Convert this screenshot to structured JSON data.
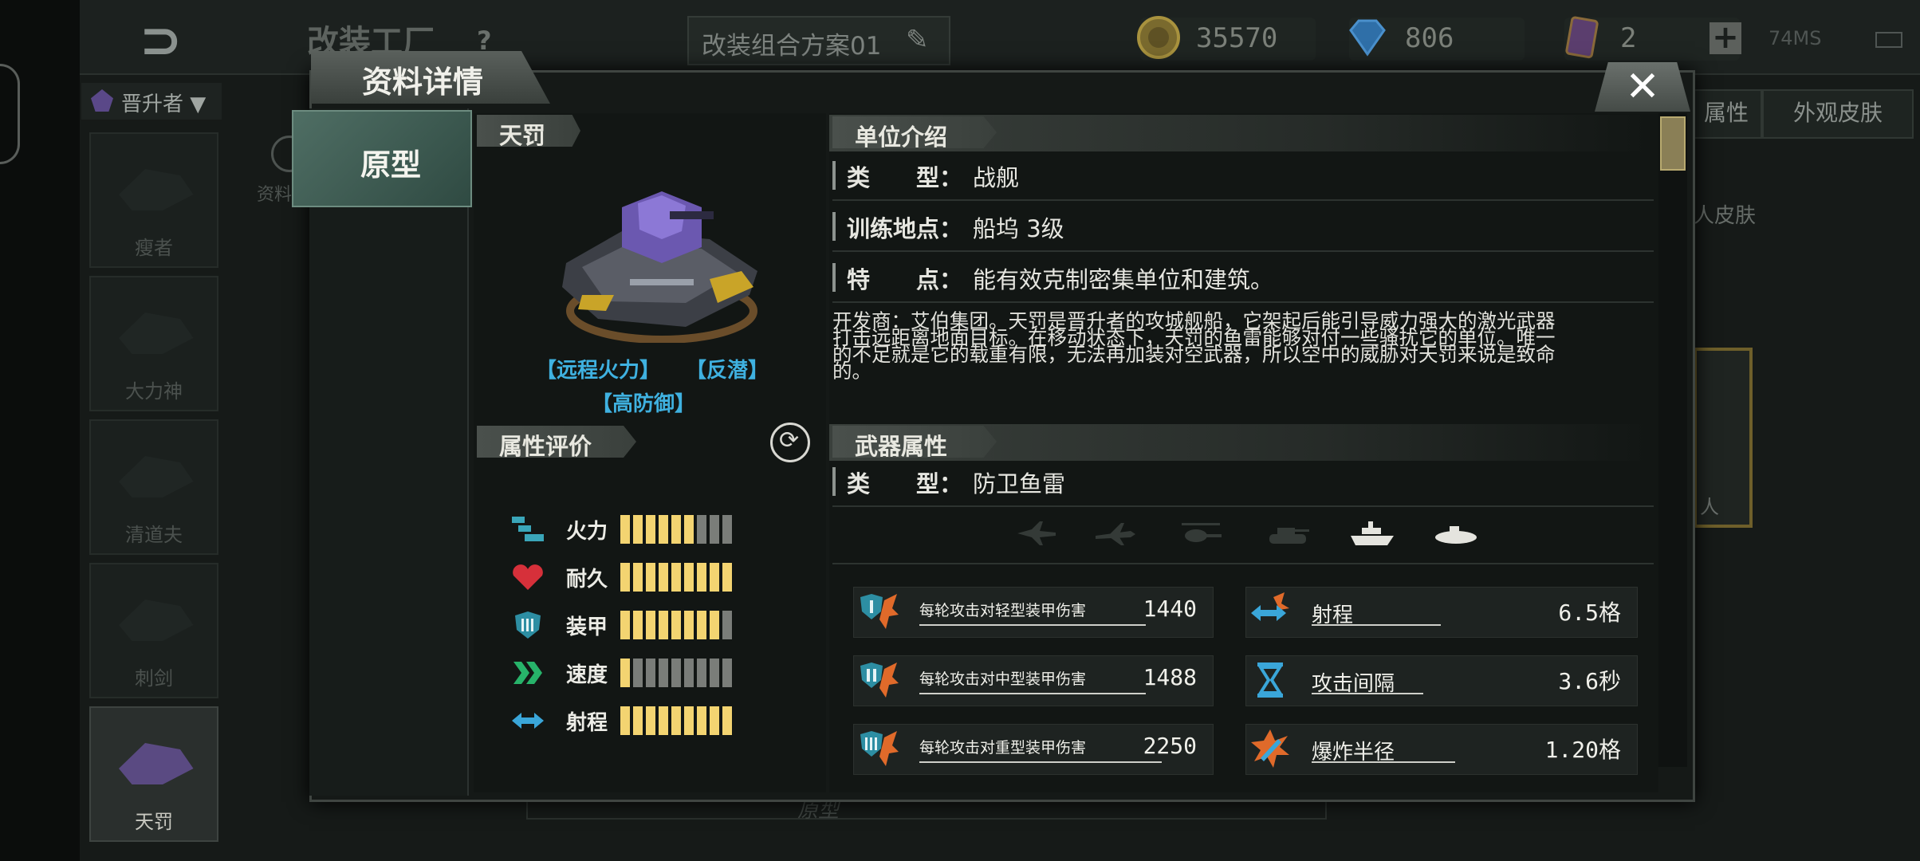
{
  "topbar": {
    "title": "改装工厂",
    "help": "?",
    "scheme_name": "改装组合方案01",
    "edit_icon": "pencil-icon",
    "gold": "35570",
    "diamond": "806",
    "cards": "2",
    "plus": "+",
    "ping": "74MS"
  },
  "sidebar": {
    "faction": "晋升者",
    "units": [
      {
        "label": "瘦者"
      },
      {
        "label": "大力神"
      },
      {
        "label": "清道夫"
      },
      {
        "label": "刺剑"
      },
      {
        "label": "天罚"
      }
    ]
  },
  "background": {
    "left_label": "资料",
    "right_tab_1": "属性",
    "right_tab_2": "外观皮肤",
    "right_text": "人皮肤",
    "card_label": "人",
    "bottom_label": "原型"
  },
  "dialog": {
    "title": "资料详情",
    "close": "✕",
    "tab_proto": "原型",
    "unit_name": "天罚",
    "tags": [
      "【远程火力】",
      "【反潜】",
      "【高防御】"
    ],
    "attr_header": "属性评价",
    "attributes": [
      {
        "name": "火力",
        "level": 6,
        "max": 9,
        "icon": "firepower-icon"
      },
      {
        "name": "耐久",
        "level": 9,
        "max": 9,
        "icon": "heart-icon"
      },
      {
        "name": "装甲",
        "level": 8,
        "max": 9,
        "icon": "shield-icon"
      },
      {
        "name": "速度",
        "level": 1,
        "max": 9,
        "icon": "chevron-speed-icon"
      },
      {
        "name": "射程",
        "level": 9,
        "max": 9,
        "icon": "range-arrows-icon"
      }
    ],
    "intro_header": "单位介绍",
    "info": [
      {
        "key": "类　　型：",
        "value": "战舰"
      },
      {
        "key": "训练地点：",
        "value": "船坞 3级"
      },
      {
        "key": "特　　点：",
        "value": "能有效克制密集单位和建筑。"
      }
    ],
    "description_lines": [
      "开发商：艾伯集团。天罚是晋升者的攻城舰船，它架起后能引导威力强大的激光武器",
      "打击远距离地面目标。在移动状态下，天罚的鱼雷能够对付一些骚扰它的单位。唯一",
      "的不足就是它的载重有限，无法再加装对空武器，所以空中的威胁对天罚来说是致命",
      "的。"
    ],
    "weapon_header": "武器属性",
    "weapon_type_key": "类　　型：",
    "weapon_type": "防卫鱼雷",
    "targets": [
      {
        "icon": "fighter-jet-icon",
        "active": false
      },
      {
        "icon": "bomber-plane-icon",
        "active": false
      },
      {
        "icon": "helicopter-icon",
        "active": false
      },
      {
        "icon": "tank-icon",
        "active": false
      },
      {
        "icon": "ship-icon",
        "active": true
      },
      {
        "icon": "submarine-icon",
        "active": true
      }
    ],
    "weapon_stats": [
      {
        "label": "每轮攻击对轻型装甲伤害",
        "value": "1440"
      },
      {
        "label": "每轮攻击对中型装甲伤害",
        "value": "1488"
      },
      {
        "label": "每轮攻击对重型装甲伤害",
        "value": "2250"
      },
      {
        "label": "射程",
        "value": "6.5格"
      },
      {
        "label": "攻击间隔",
        "value": "3.6秒"
      },
      {
        "label": "爆炸半径",
        "value": "1.20格"
      }
    ]
  },
  "colors": {
    "tag_blue": "#3fb1e0",
    "bar_on": "#f3d471",
    "bar_off": "#7a7d79"
  }
}
